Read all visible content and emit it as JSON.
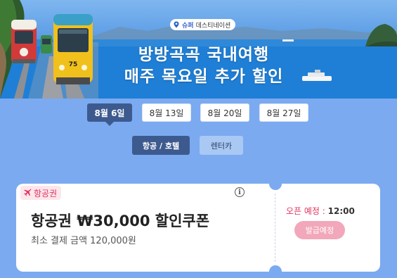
{
  "banner": {
    "badge_super": "슈퍼",
    "badge_destination": "데스티네이션",
    "headline_line1": "방방곡곡 국내여행",
    "headline_line2": "매주 목요일 추가 할인",
    "tram_number": "75"
  },
  "date_tabs": [
    {
      "label": "8월 6일",
      "active": true
    },
    {
      "label": "8월 13일",
      "active": false
    },
    {
      "label": "8월 20일",
      "active": false
    },
    {
      "label": "8월 27일",
      "active": false
    }
  ],
  "category_tabs": [
    {
      "label": "항공 / 호텔",
      "active": true
    },
    {
      "label": "렌터카",
      "active": false
    }
  ],
  "coupon": {
    "type_label": "항공권",
    "title": "항공권 ₩30,000 할인쿠폰",
    "subtitle": "최소 결제 금액 120,000원",
    "open_label": "오픈 예정 : ",
    "open_time": "12:00",
    "issue_button": "발급예정",
    "info_glyph": "i"
  },
  "colors": {
    "page_bg": "#7baaf0",
    "active_tab": "#3d5a8f",
    "accent_pink": "#e0335f",
    "issue_button_bg": "#f2a7ba"
  }
}
